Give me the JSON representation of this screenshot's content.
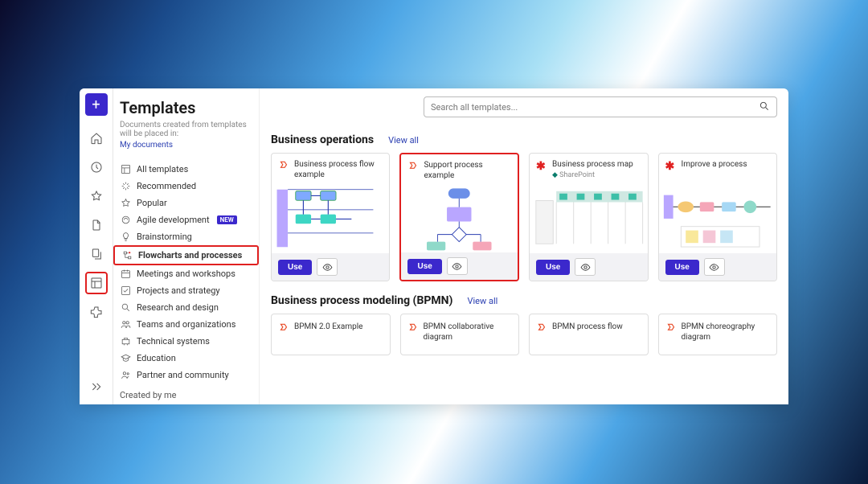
{
  "page": {
    "title": "Templates",
    "subtitle_prefix": "Documents created from templates will be placed in:",
    "subtitle_link": "My documents"
  },
  "search": {
    "placeholder": "Search all templates..."
  },
  "rail": {
    "new_label": "+"
  },
  "categories": [
    {
      "icon": "template",
      "label": "All templates"
    },
    {
      "icon": "sparkle",
      "label": "Recommended"
    },
    {
      "icon": "star",
      "label": "Popular"
    },
    {
      "icon": "agile",
      "label": "Agile development",
      "badge": "NEW"
    },
    {
      "icon": "bulb",
      "label": "Brainstorming"
    },
    {
      "icon": "flow",
      "label": "Flowcharts and processes",
      "highlight": true
    },
    {
      "icon": "calendar",
      "label": "Meetings and workshops"
    },
    {
      "icon": "check",
      "label": "Projects and strategy"
    },
    {
      "icon": "search",
      "label": "Research and design"
    },
    {
      "icon": "team",
      "label": "Teams and organizations"
    },
    {
      "icon": "tech",
      "label": "Technical systems"
    },
    {
      "icon": "edu",
      "label": "Education"
    },
    {
      "icon": "partner",
      "label": "Partner and community"
    }
  ],
  "created_by_me": "Created by me",
  "sections": [
    {
      "title": "Business operations",
      "view_all": "View all",
      "cards": [
        {
          "icon": "lucid-red",
          "title": "Business process flow example",
          "use": "Use"
        },
        {
          "icon": "lucid-red",
          "title": "Support process example",
          "use": "Use",
          "highlight": true
        },
        {
          "icon": "asterisk-red",
          "title": "Business process map",
          "subtitle": "SharePoint",
          "use": "Use"
        },
        {
          "icon": "asterisk-red",
          "title": "Improve a process",
          "use": "Use"
        }
      ]
    },
    {
      "title": "Business process modeling (BPMN)",
      "view_all": "View all",
      "cards": [
        {
          "icon": "lucid-red",
          "title": "BPMN 2.0 Example"
        },
        {
          "icon": "lucid-red",
          "title": "BPMN collaborative diagram"
        },
        {
          "icon": "lucid-red",
          "title": "BPMN process flow"
        },
        {
          "icon": "lucid-red",
          "title": "BPMN choreography diagram"
        }
      ]
    }
  ]
}
